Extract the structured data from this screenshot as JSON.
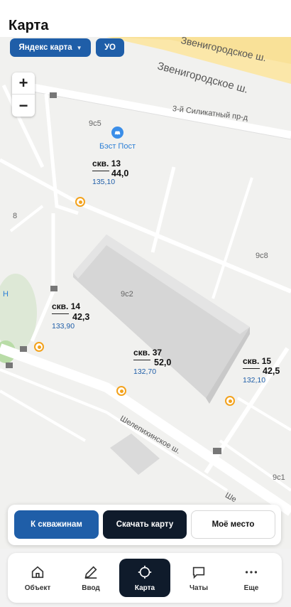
{
  "header": {
    "title": "Карта"
  },
  "map": {
    "source_selector": "Яндекс карта",
    "layer_chip": "УО",
    "zoom": {
      "in": "+",
      "out": "−"
    },
    "labels": {
      "building_9c5": "9с5",
      "building_9c2": "9с2",
      "building_9c8": "9с8",
      "building_8": "8",
      "building_9c1": "9с1",
      "street_zvenigorodskoe_top": "Звенигородское ш.",
      "street_zvenigorodskoe": "Звенигородское ш.",
      "street_silikatny": "3-й Силикатный пр-д",
      "street_shelepikhinskoe": "Шелепихинское ш.",
      "street_she_cut": "Ше",
      "edge_n": "Н"
    },
    "poi": {
      "icon": "car-service-icon",
      "label": "Бэст Пост"
    },
    "wells": [
      {
        "name": "скв. 13",
        "value": "44,0",
        "sub": "135,10"
      },
      {
        "name": "скв. 14",
        "value": "42,3",
        "sub": "133,90"
      },
      {
        "name": "скв. 37",
        "value": "52,0",
        "sub": "132,70"
      },
      {
        "name": "скв. 15",
        "value": "42,5",
        "sub": "132,10"
      }
    ]
  },
  "actions": {
    "wells_button": "К скважинам",
    "download_button": "Скачать карту",
    "my_location_button": "Моё место"
  },
  "nav": {
    "items": [
      {
        "label": "Объект",
        "icon": "home-icon"
      },
      {
        "label": "Ввод",
        "icon": "pencil-icon"
      },
      {
        "label": "Карта",
        "icon": "crosshair-icon"
      },
      {
        "label": "Чаты",
        "icon": "chat-icon"
      },
      {
        "label": "Еще",
        "icon": "more-dots-icon"
      }
    ],
    "active": "Карта"
  },
  "colors": {
    "primary": "#1f5ea8",
    "dark": "#0f1b2b",
    "well_marker": "#f3a21c",
    "poi": "#3b8ee8",
    "map_bg": "#f1f1ef"
  }
}
